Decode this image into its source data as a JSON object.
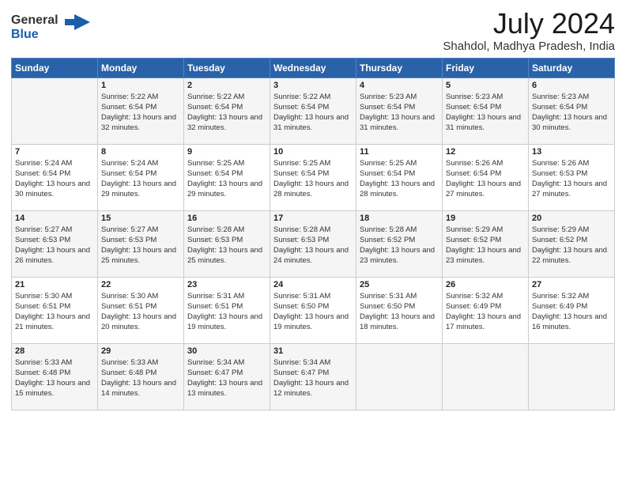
{
  "header": {
    "logo_general": "General",
    "logo_blue": "Blue",
    "month_year": "July 2024",
    "location": "Shahdol, Madhya Pradesh, India"
  },
  "days_of_week": [
    "Sunday",
    "Monday",
    "Tuesday",
    "Wednesday",
    "Thursday",
    "Friday",
    "Saturday"
  ],
  "weeks": [
    [
      {
        "num": "",
        "sunrise": "",
        "sunset": "",
        "daylight": ""
      },
      {
        "num": "1",
        "sunrise": "5:22 AM",
        "sunset": "6:54 PM",
        "daylight": "13 hours and 32 minutes."
      },
      {
        "num": "2",
        "sunrise": "5:22 AM",
        "sunset": "6:54 PM",
        "daylight": "13 hours and 32 minutes."
      },
      {
        "num": "3",
        "sunrise": "5:22 AM",
        "sunset": "6:54 PM",
        "daylight": "13 hours and 31 minutes."
      },
      {
        "num": "4",
        "sunrise": "5:23 AM",
        "sunset": "6:54 PM",
        "daylight": "13 hours and 31 minutes."
      },
      {
        "num": "5",
        "sunrise": "5:23 AM",
        "sunset": "6:54 PM",
        "daylight": "13 hours and 31 minutes."
      },
      {
        "num": "6",
        "sunrise": "5:23 AM",
        "sunset": "6:54 PM",
        "daylight": "13 hours and 30 minutes."
      }
    ],
    [
      {
        "num": "7",
        "sunrise": "5:24 AM",
        "sunset": "6:54 PM",
        "daylight": "13 hours and 30 minutes."
      },
      {
        "num": "8",
        "sunrise": "5:24 AM",
        "sunset": "6:54 PM",
        "daylight": "13 hours and 29 minutes."
      },
      {
        "num": "9",
        "sunrise": "5:25 AM",
        "sunset": "6:54 PM",
        "daylight": "13 hours and 29 minutes."
      },
      {
        "num": "10",
        "sunrise": "5:25 AM",
        "sunset": "6:54 PM",
        "daylight": "13 hours and 28 minutes."
      },
      {
        "num": "11",
        "sunrise": "5:25 AM",
        "sunset": "6:54 PM",
        "daylight": "13 hours and 28 minutes."
      },
      {
        "num": "12",
        "sunrise": "5:26 AM",
        "sunset": "6:54 PM",
        "daylight": "13 hours and 27 minutes."
      },
      {
        "num": "13",
        "sunrise": "5:26 AM",
        "sunset": "6:53 PM",
        "daylight": "13 hours and 27 minutes."
      }
    ],
    [
      {
        "num": "14",
        "sunrise": "5:27 AM",
        "sunset": "6:53 PM",
        "daylight": "13 hours and 26 minutes."
      },
      {
        "num": "15",
        "sunrise": "5:27 AM",
        "sunset": "6:53 PM",
        "daylight": "13 hours and 25 minutes."
      },
      {
        "num": "16",
        "sunrise": "5:28 AM",
        "sunset": "6:53 PM",
        "daylight": "13 hours and 25 minutes."
      },
      {
        "num": "17",
        "sunrise": "5:28 AM",
        "sunset": "6:53 PM",
        "daylight": "13 hours and 24 minutes."
      },
      {
        "num": "18",
        "sunrise": "5:28 AM",
        "sunset": "6:52 PM",
        "daylight": "13 hours and 23 minutes."
      },
      {
        "num": "19",
        "sunrise": "5:29 AM",
        "sunset": "6:52 PM",
        "daylight": "13 hours and 23 minutes."
      },
      {
        "num": "20",
        "sunrise": "5:29 AM",
        "sunset": "6:52 PM",
        "daylight": "13 hours and 22 minutes."
      }
    ],
    [
      {
        "num": "21",
        "sunrise": "5:30 AM",
        "sunset": "6:51 PM",
        "daylight": "13 hours and 21 minutes."
      },
      {
        "num": "22",
        "sunrise": "5:30 AM",
        "sunset": "6:51 PM",
        "daylight": "13 hours and 20 minutes."
      },
      {
        "num": "23",
        "sunrise": "5:31 AM",
        "sunset": "6:51 PM",
        "daylight": "13 hours and 19 minutes."
      },
      {
        "num": "24",
        "sunrise": "5:31 AM",
        "sunset": "6:50 PM",
        "daylight": "13 hours and 19 minutes."
      },
      {
        "num": "25",
        "sunrise": "5:31 AM",
        "sunset": "6:50 PM",
        "daylight": "13 hours and 18 minutes."
      },
      {
        "num": "26",
        "sunrise": "5:32 AM",
        "sunset": "6:49 PM",
        "daylight": "13 hours and 17 minutes."
      },
      {
        "num": "27",
        "sunrise": "5:32 AM",
        "sunset": "6:49 PM",
        "daylight": "13 hours and 16 minutes."
      }
    ],
    [
      {
        "num": "28",
        "sunrise": "5:33 AM",
        "sunset": "6:48 PM",
        "daylight": "13 hours and 15 minutes."
      },
      {
        "num": "29",
        "sunrise": "5:33 AM",
        "sunset": "6:48 PM",
        "daylight": "13 hours and 14 minutes."
      },
      {
        "num": "30",
        "sunrise": "5:34 AM",
        "sunset": "6:47 PM",
        "daylight": "13 hours and 13 minutes."
      },
      {
        "num": "31",
        "sunrise": "5:34 AM",
        "sunset": "6:47 PM",
        "daylight": "13 hours and 12 minutes."
      },
      {
        "num": "",
        "sunrise": "",
        "sunset": "",
        "daylight": ""
      },
      {
        "num": "",
        "sunrise": "",
        "sunset": "",
        "daylight": ""
      },
      {
        "num": "",
        "sunrise": "",
        "sunset": "",
        "daylight": ""
      }
    ]
  ],
  "labels": {
    "sunrise_prefix": "Sunrise: ",
    "sunset_prefix": "Sunset: ",
    "daylight_prefix": "Daylight: "
  }
}
